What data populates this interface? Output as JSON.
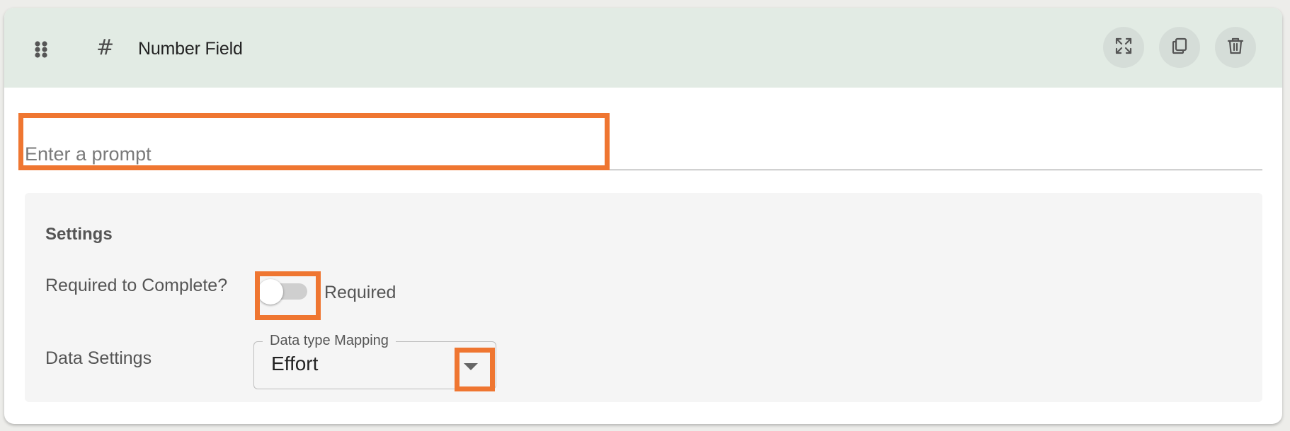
{
  "header": {
    "field_icon": "#",
    "title": "Number Field",
    "buttons": [
      {
        "name": "expand-icon"
      },
      {
        "name": "duplicate-icon"
      },
      {
        "name": "trash-icon"
      }
    ]
  },
  "prompt": {
    "placeholder": "Enter a prompt",
    "value": ""
  },
  "settings": {
    "title": "Settings",
    "required": {
      "label": "Required to Complete?",
      "toggle_label": "Required",
      "checked": false
    },
    "data_settings": {
      "label": "Data Settings",
      "select_legend": "Data type Mapping",
      "select_value": "Effort"
    }
  },
  "colors": {
    "header_bg": "#e2ebe4",
    "highlight": "#ef7631",
    "settings_bg": "#f5f5f5"
  }
}
